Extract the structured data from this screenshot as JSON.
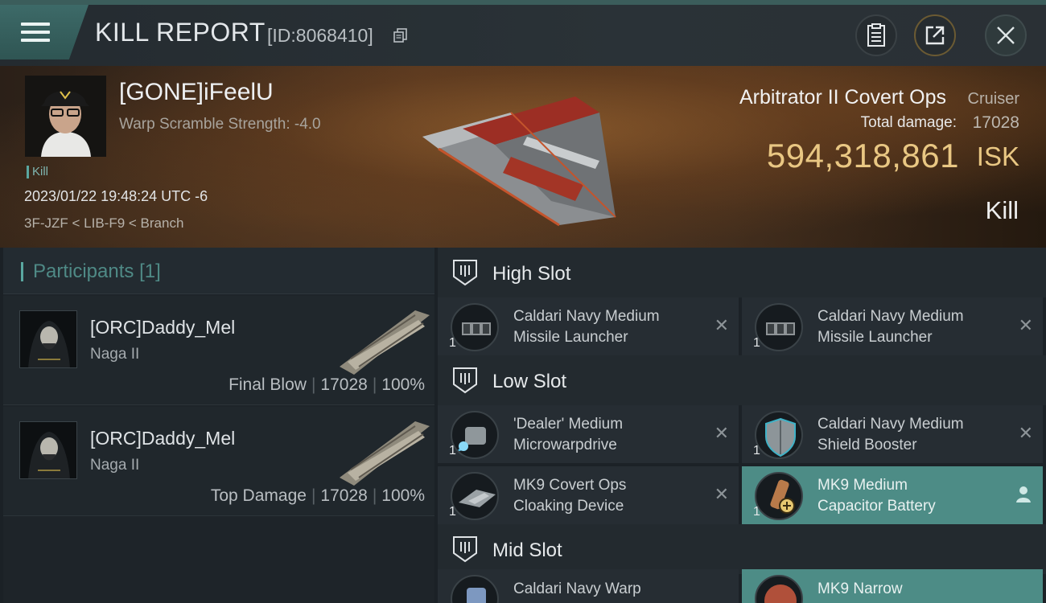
{
  "header": {
    "title": "KILL REPORT",
    "report_id": "[ID:8068410]"
  },
  "victim": {
    "name": "[GONE]iFeelU",
    "warp_scramble": "Warp Scramble Strength: -4.0",
    "kill_tag": "Kill",
    "datetime": "2023/01/22 19:48:24 UTC -6",
    "location": "3F-JZF < LIB-F9 < Branch",
    "ship_name": "Arbitrator II Covert Ops",
    "ship_class": "Cruiser",
    "total_damage_label": "Total damage:",
    "total_damage": "17028",
    "isk_value": "594,318,861",
    "isk_unit": "ISK",
    "result": "Kill"
  },
  "participants": {
    "title": "Participants",
    "count": "[1]",
    "rows": [
      {
        "name": "[ORC]Daddy_Mel",
        "ship": "Naga II",
        "role": "Final Blow",
        "damage": "17028",
        "percent": "100%"
      },
      {
        "name": "[ORC]Daddy_Mel",
        "ship": "Naga II",
        "role": "Top Damage",
        "damage": "17028",
        "percent": "100%"
      }
    ]
  },
  "slots": {
    "high": {
      "title": "High Slot",
      "items": [
        {
          "line1": "Caldari Navy Medium",
          "line2": "Missile Launcher",
          "qty": "1"
        },
        {
          "line1": "Caldari Navy Medium",
          "line2": "Missile Launcher",
          "qty": "1"
        }
      ]
    },
    "low": {
      "title": "Low Slot",
      "items": [
        {
          "line1": "'Dealer' Medium",
          "line2": "Microwarpdrive",
          "qty": "1"
        },
        {
          "line1": "Caldari Navy Medium",
          "line2": "Shield Booster",
          "qty": "1"
        },
        {
          "line1": "MK9 Covert Ops",
          "line2": "Cloaking Device",
          "qty": "1"
        },
        {
          "line1": "MK9 Medium",
          "line2": "Capacitor Battery",
          "qty": "1"
        }
      ]
    },
    "mid": {
      "title": "Mid Slot",
      "items": [
        {
          "line1": "Caldari Navy Warp",
          "line2": "",
          "qty": ""
        },
        {
          "line1": "MK9 Narrow",
          "line2": "",
          "qty": ""
        }
      ]
    }
  },
  "colors": {
    "accent_teal": "#5aa7a0",
    "isk_gold": "#e9c783",
    "highlight_item": "#4d8c86"
  }
}
